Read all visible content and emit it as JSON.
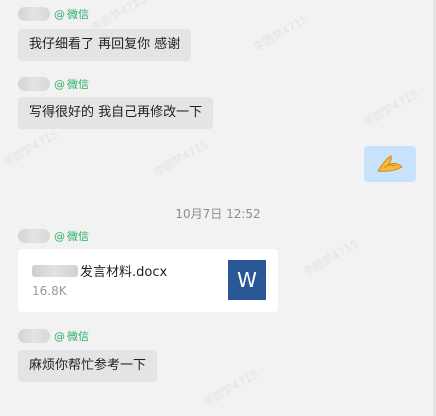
{
  "messages": [
    {
      "sender_at": "@",
      "sender_platform": "微信",
      "text": "我仔细看了 再回复你 感谢"
    },
    {
      "sender_at": "@",
      "sender_platform": "微信",
      "text": "写得很好的 我自己再修改一下"
    }
  ],
  "outgoing": {
    "emoji": "clasping-hands-emoji"
  },
  "timestamp": "10月7日 12:52",
  "file_message": {
    "sender_at": "@",
    "sender_platform": "微信",
    "file_name": "发言材料.docx",
    "file_size": "16.8K",
    "file_icon_letter": "W",
    "icon_color": "#2b5797"
  },
  "last_message": {
    "sender_at": "@",
    "sender_platform": "微信",
    "text": "麻烦你帮忙参考一下"
  },
  "watermark_text": "李圆梦4715"
}
